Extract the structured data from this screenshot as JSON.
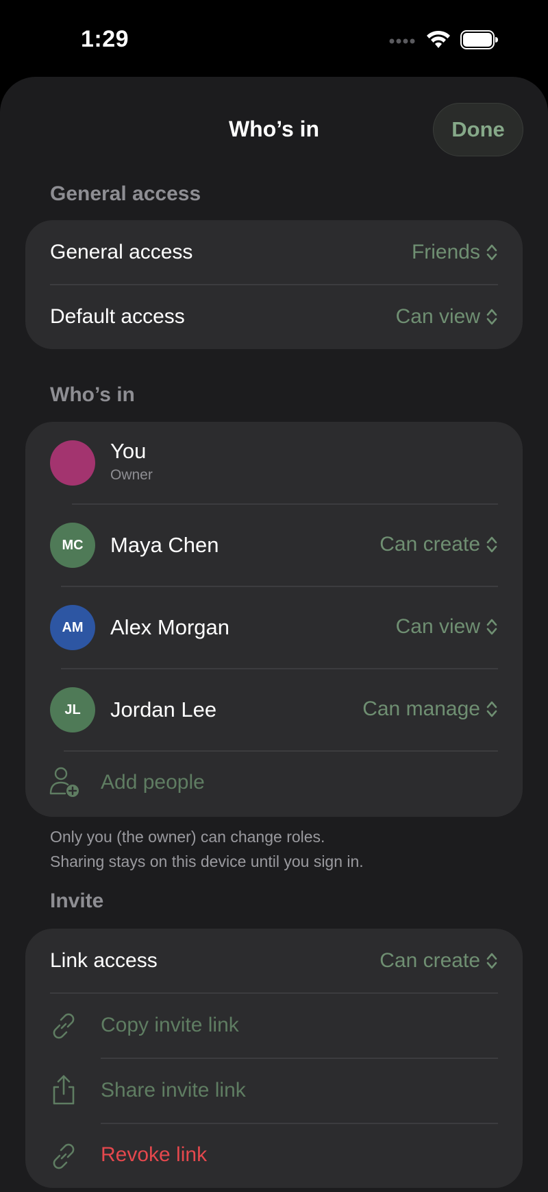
{
  "status_bar": {
    "time": "1:29"
  },
  "header": {
    "title": "Who’s in",
    "done_label": "Done"
  },
  "general_access": {
    "section_label": "General access",
    "rows": [
      {
        "label": "General access",
        "value": "Friends"
      },
      {
        "label": "Default access",
        "value": "Can view"
      }
    ]
  },
  "whos_in": {
    "section_label": "Who’s in",
    "owner": {
      "name": "You",
      "role": "Owner",
      "avatar_color": "#a3346f"
    },
    "members": [
      {
        "initials": "MC",
        "name": "Maya Chen",
        "role": "Can create",
        "avatar_color": "#4f7a57"
      },
      {
        "initials": "AM",
        "name": "Alex Morgan",
        "role": "Can view",
        "avatar_color": "#2d56a3"
      },
      {
        "initials": "JL",
        "name": "Jordan Lee",
        "role": "Can manage",
        "avatar_color": "#4f7a57"
      }
    ],
    "add_people_label": "Add people"
  },
  "footnote": {
    "line1": "Only you (the owner) can change roles.",
    "line2": "Sharing stays on this device until you sign in."
  },
  "invite": {
    "section_label": "Invite",
    "link_access_label": "Link access",
    "link_access_value": "Can create",
    "copy_label": "Copy invite link",
    "share_label": "Share invite link",
    "revoke_label": "Revoke link"
  },
  "colors": {
    "accent": "#6f8f72",
    "destructive": "#e5484d",
    "sheet_background": "#1c1c1e",
    "group_background": "#2c2c2e"
  },
  "icons": [
    "wifi-icon",
    "battery-icon",
    "signal-dots-icon",
    "chevron-up-down-icon",
    "add-person-icon",
    "link-icon",
    "share-icon"
  ]
}
